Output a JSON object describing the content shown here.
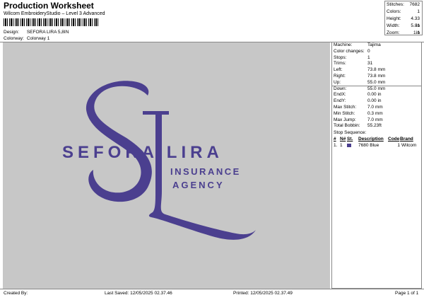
{
  "header": {
    "title": "Production Worksheet",
    "subtitle": "Wilcom EmbroideryStudio – Level 3 Advanced",
    "design_label": "Design:",
    "design_value": "SEFORA LIRA 5,8IN",
    "colorway_label": "Colorway:",
    "colorway_value": "Colorway 1"
  },
  "summary": {
    "stitches_label": "Stitches:",
    "stitches_value": "7682",
    "colors_label": "Colors:",
    "colors_value": "1",
    "height_label": "Height:",
    "height_value": "4.33 in",
    "width_label": "Width:",
    "width_value": "5.81 in",
    "zoom_label": "Zoom:",
    "zoom_value": "1:1"
  },
  "specs": [
    {
      "label": "Machine:",
      "value": "Tajima"
    },
    {
      "label": "Color changes:",
      "value": "0"
    },
    {
      "label": "Stops:",
      "value": "1"
    },
    {
      "label": "Trims:",
      "value": "31"
    },
    {
      "label": "Left:",
      "value": "73.8 mm"
    },
    {
      "label": "Right:",
      "value": "73.8 mm"
    },
    {
      "label": "Up:",
      "value": "55.0 mm"
    },
    {
      "label": "Down:",
      "value": "55.0 mm"
    },
    {
      "label": "EndX:",
      "value": "0.00 in"
    },
    {
      "label": "EndY:",
      "value": "0.00 in"
    },
    {
      "label": "Max Stitch:",
      "value": "7.0 mm"
    },
    {
      "label": "Min Stitch:",
      "value": "0.3 mm"
    },
    {
      "label": "Max Jump:",
      "value": "7.0 mm"
    },
    {
      "label": "Total Bobbin:",
      "value": "55.23ft"
    }
  ],
  "stop_sequence": {
    "title": "Stop Sequence:",
    "headers": [
      "#",
      "N#",
      "St.",
      "Description",
      "Code",
      "Brand"
    ],
    "rows": [
      {
        "num": "1.",
        "needle": "1",
        "stitches": "7680",
        "description": "Blue",
        "code": "1",
        "brand": "Wilcom",
        "color": "#4b3f8f"
      }
    ]
  },
  "design": {
    "line1": "SEFORA LIRA",
    "line2": "INSURANCE",
    "line3": "AGENCY",
    "thread_color": "#4b3f8f"
  },
  "footer": {
    "created_by": "Created By:",
    "last_saved": "Last Saved: 12/05/2025 02.37.46",
    "printed": "Printed: 12/05/2025 02.37.49",
    "page": "Page 1 of 1"
  }
}
